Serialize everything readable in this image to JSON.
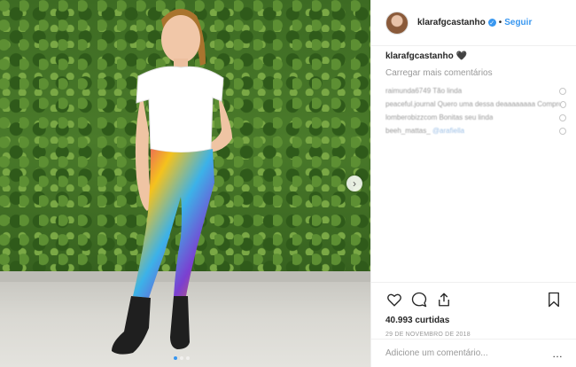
{
  "post": {
    "author": "klarafgcastanho",
    "verified": true,
    "separator": "•",
    "follow_label": "Seguir",
    "caption_author": "klarafgcastanho",
    "caption_text": "🖤",
    "load_more_label": "Carregar mais comentários",
    "comments": [
      {
        "text": "raimunda6749 Tão linda"
      },
      {
        "text": "peaceful.journal Quero uma dessa deaaaaaaaa Comprou onde?"
      },
      {
        "text": "lomberobizzcom Bonitas seu linda"
      },
      {
        "text": "beeh_mattas_",
        "mention": "@arafiella"
      }
    ],
    "likes_label": "40.993 curtidas",
    "date_label": "29 de novembro de 2018",
    "comment_placeholder": "Adicione um comentário...",
    "more_label": "…"
  },
  "colors": {
    "accent": "#3897f0",
    "text": "#262626",
    "muted": "#999999"
  },
  "icons": [
    "next-arrow-icon",
    "heart-icon",
    "comment-icon",
    "share-icon",
    "bookmark-icon",
    "verified-icon"
  ]
}
